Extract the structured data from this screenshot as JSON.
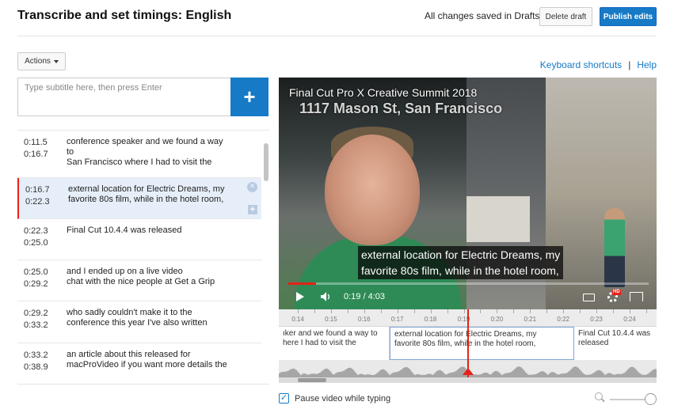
{
  "header": {
    "title": "Transcribe and set timings: English",
    "saved_status": "All changes saved in Drafts",
    "delete_label": "Delete draft",
    "publish_label": "Publish edits"
  },
  "toolbar": {
    "actions_label": "Actions",
    "keyboard_shortcuts": "Keyboard shortcuts",
    "separator": "|",
    "help": "Help"
  },
  "subtitle_input": {
    "placeholder": "Type subtitle here, then press Enter",
    "add_symbol": "+"
  },
  "cues": [
    {
      "start": "0:11.5",
      "end": "0:16.7",
      "text": "conference speaker and we found a way to\nSan Francisco where I had to visit the",
      "active": false
    },
    {
      "start": "0:16.7",
      "end": "0:22.3",
      "text": "external location for Electric Dreams, my favorite 80s film, while in the hotel room,",
      "active": true
    },
    {
      "start": "0:22.3",
      "end": "0:25.0",
      "text": "Final Cut 10.4.4 was released",
      "active": false
    },
    {
      "start": "0:25.0",
      "end": "0:29.2",
      "text": "and I ended up on a live video\nchat with the nice people at Get a Grip",
      "active": false
    },
    {
      "start": "0:29.2",
      "end": "0:33.2",
      "text": "who sadly couldn't make it to the\nconference this year I've also written",
      "active": false
    },
    {
      "start": "0:33.2",
      "end": "0:38.9",
      "text": "an article about this released for\nmacProVideo if you want more details the",
      "active": false
    }
  ],
  "player": {
    "video_title": "Final Cut Pro X Creative Summit 2018",
    "video_subtitle": "1117 Mason St, San Francisco",
    "caption_line1": "external location for Electric Dreams, my",
    "caption_line2": "favorite 80s film, while in the hotel room,",
    "time_display": "0:19 / 4:03",
    "progress_fraction": 0.078,
    "hd_badge": "HD",
    "accent_color": "#e62117"
  },
  "timeline": {
    "ticks": [
      "0:14",
      "0:15",
      "0:16",
      "0:17",
      "0:18",
      "0:19",
      "0:20",
      "0:21",
      "0:22",
      "0:23",
      "0:24"
    ],
    "segments": [
      {
        "text": "ıker and we found a way to\nhere I had to visit the",
        "active": false
      },
      {
        "text": "external location for Electric Dreams, my\nfavorite 80s film, while in the hotel room,",
        "active": true
      },
      {
        "text": "Final Cut 10.4.4 was\nreleased",
        "active": false
      }
    ]
  },
  "footer": {
    "pause_label": "Pause video while typing",
    "pause_checked": true,
    "check_glyph": "✓"
  },
  "colors": {
    "primary_blue": "#167ac6",
    "active_row_bg": "#e6eff9",
    "red": "#e62117"
  }
}
